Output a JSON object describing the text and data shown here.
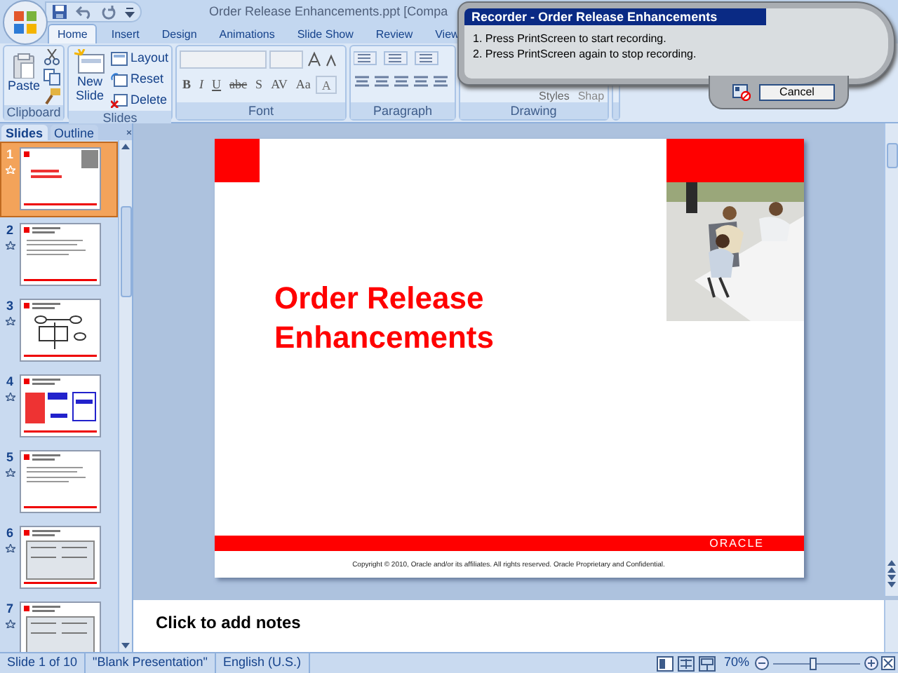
{
  "window": {
    "title": "Order Release Enhancements.ppt [Compa"
  },
  "ribbon_tabs": [
    {
      "label": "Home",
      "selected": true
    },
    {
      "label": "Insert",
      "selected": false
    },
    {
      "label": "Design",
      "selected": false
    },
    {
      "label": "Animations",
      "selected": false
    },
    {
      "label": "Slide Show",
      "selected": false
    },
    {
      "label": "Review",
      "selected": false
    },
    {
      "label": "View",
      "selected": false
    }
  ],
  "ribbon": {
    "clipboard": {
      "label": "Clipboard",
      "paste": "Paste"
    },
    "slides": {
      "label": "Slides",
      "new_slide": "New",
      "new_slide_2": "Slide",
      "layout": "Layout",
      "reset": "Reset",
      "delete": "Delete"
    },
    "font": {
      "label": "Font",
      "buttons": [
        "B",
        "I",
        "U",
        "abc",
        "S",
        "AV",
        "Aa"
      ],
      "color_button": "A"
    },
    "paragraph": {
      "label": "Paragraph"
    },
    "drawing": {
      "label": "Drawing",
      "styles": "Styles",
      "shape": "Shap"
    }
  },
  "pane_tabs": [
    {
      "label": "Slides",
      "selected": true
    },
    {
      "label": "Outline",
      "selected": false
    }
  ],
  "thumbnails": [
    {
      "number": "1",
      "selected": true,
      "kind": "title"
    },
    {
      "number": "2",
      "selected": false,
      "kind": "text"
    },
    {
      "number": "3",
      "selected": false,
      "kind": "diagram"
    },
    {
      "number": "4",
      "selected": false,
      "kind": "boxes"
    },
    {
      "number": "5",
      "selected": false,
      "kind": "text"
    },
    {
      "number": "6",
      "selected": false,
      "kind": "screen"
    },
    {
      "number": "7",
      "selected": false,
      "kind": "screen"
    }
  ],
  "slide": {
    "title": "Order Release Enhancements",
    "logo": "ORACLE",
    "footer": "Copyright © 2010, Oracle and/or its affiliates. All rights reserved. Oracle Proprietary and Confidential."
  },
  "notes": {
    "prompt": "Click to add notes"
  },
  "status_bar": {
    "slide": "Slide 1 of 10",
    "theme": "\"Blank Presentation\"",
    "language": "English (U.S.)",
    "zoom": "70%",
    "zoom_slider": {
      "level": 0.45
    }
  },
  "recorder": {
    "title": "Recorder - Order Release Enhancements",
    "steps": [
      "1. Press PrintScreen to start recording.",
      "2. Press PrintScreen again to stop recording."
    ],
    "cancel": "Cancel"
  }
}
